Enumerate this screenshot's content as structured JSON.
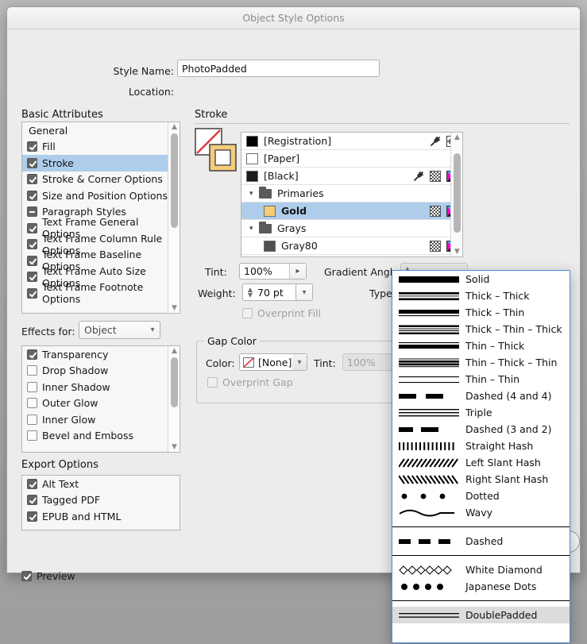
{
  "window": {
    "title": "Object Style Options"
  },
  "form": {
    "style_name_label": "Style Name:",
    "style_name_value": "PhotoPadded",
    "location_label": "Location:",
    "location_value": ""
  },
  "basic_attributes": {
    "title": "Basic Attributes",
    "items": [
      {
        "label": "General",
        "checkbox": "none",
        "selected": false
      },
      {
        "label": "Fill",
        "checkbox": "checked",
        "selected": false
      },
      {
        "label": "Stroke",
        "checkbox": "checked",
        "selected": true
      },
      {
        "label": "Stroke & Corner Options",
        "checkbox": "checked",
        "selected": false
      },
      {
        "label": "Size and Position Options",
        "checkbox": "checked",
        "selected": false
      },
      {
        "label": "Paragraph Styles",
        "checkbox": "dash",
        "selected": false
      },
      {
        "label": "Text Frame General Options",
        "checkbox": "checked",
        "selected": false
      },
      {
        "label": "Text Frame Column Rule Options",
        "checkbox": "checked",
        "selected": false
      },
      {
        "label": "Text Frame Baseline Options",
        "checkbox": "checked",
        "selected": false
      },
      {
        "label": "Text Frame Auto Size Options",
        "checkbox": "checked",
        "selected": false
      },
      {
        "label": "Text Frame Footnote Options",
        "checkbox": "checked",
        "selected": false
      }
    ]
  },
  "effects": {
    "label": "Effects for:",
    "selected": "Object",
    "items": [
      {
        "label": "Transparency",
        "checkbox": "checked"
      },
      {
        "label": "Drop Shadow",
        "checkbox": "unchecked"
      },
      {
        "label": "Inner Shadow",
        "checkbox": "unchecked"
      },
      {
        "label": "Outer Glow",
        "checkbox": "unchecked"
      },
      {
        "label": "Inner Glow",
        "checkbox": "unchecked"
      },
      {
        "label": "Bevel and Emboss",
        "checkbox": "unchecked"
      }
    ]
  },
  "export_options": {
    "title": "Export Options",
    "items": [
      {
        "label": "Alt Text",
        "checkbox": "checked"
      },
      {
        "label": "Tagged PDF",
        "checkbox": "checked"
      },
      {
        "label": "EPUB and HTML",
        "checkbox": "checked"
      }
    ]
  },
  "preview": {
    "label": "Preview",
    "checkbox": "checked"
  },
  "stroke": {
    "title": "Stroke",
    "swatches": [
      {
        "name": "[Registration]",
        "color": "#000000",
        "indent": 0,
        "type": "swatch",
        "selected": false,
        "icons": [
          "ink-icon",
          "registration-icon"
        ]
      },
      {
        "name": "[Paper]",
        "color": "#ffffff",
        "indent": 0,
        "type": "swatch",
        "selected": false,
        "icons": []
      },
      {
        "name": "[Black]",
        "color": "#1b1b1b",
        "indent": 0,
        "type": "swatch",
        "selected": false,
        "icons": [
          "ink-icon",
          "tint-icon",
          "cmyk-icon"
        ]
      },
      {
        "name": "Primaries",
        "color": "",
        "indent": 0,
        "type": "group",
        "selected": false,
        "icons": []
      },
      {
        "name": "Gold",
        "color": "#f5cc78",
        "indent": 1,
        "type": "swatch",
        "selected": true,
        "icons": [
          "tint-icon",
          "cmyk-icon"
        ]
      },
      {
        "name": "Grays",
        "color": "",
        "indent": 0,
        "type": "group",
        "selected": false,
        "icons": []
      },
      {
        "name": "Gray80",
        "color": "#4f4f4f",
        "indent": 1,
        "type": "swatch",
        "selected": false,
        "icons": [
          "tint-icon",
          "cmyk-icon"
        ]
      }
    ],
    "tint_label": "Tint:",
    "tint_value": "100%",
    "gradient_angle_label": "Gradient Angle:",
    "gradient_angle_value": "",
    "weight_label": "Weight:",
    "weight_value": "70 pt",
    "type_label": "Type:",
    "type_value": "triple-rule-preview",
    "overprint_fill_label": "Overprint Fill",
    "overprint_fill_checkbox": "unchecked"
  },
  "gap_color": {
    "legend": "Gap Color",
    "color_label": "Color:",
    "color_value": "[None]",
    "tint_label": "Tint:",
    "tint_value": "100%",
    "overprint_gap_label": "Overprint Gap",
    "overprint_gap_checkbox": "unchecked"
  },
  "stroke_type_menu": {
    "groups": [
      {
        "items": [
          {
            "label": "Solid",
            "preview": "solid",
            "highlighted": false
          },
          {
            "label": "Thick – Thick",
            "preview": "thick-thick",
            "highlighted": false
          },
          {
            "label": "Thick – Thin",
            "preview": "thick-thin",
            "highlighted": false
          },
          {
            "label": "Thick – Thin – Thick",
            "preview": "thick-thin-thick",
            "highlighted": false
          },
          {
            "label": "Thin – Thick",
            "preview": "thin-thick",
            "highlighted": false
          },
          {
            "label": "Thin – Thick – Thin",
            "preview": "thin-thick-thin",
            "highlighted": false
          },
          {
            "label": "Thin – Thin",
            "preview": "thin-thin",
            "highlighted": false
          },
          {
            "label": "Dashed (4 and 4)",
            "preview": "dashed-4-4",
            "highlighted": false
          },
          {
            "label": "Triple",
            "preview": "triple",
            "highlighted": false
          },
          {
            "label": "Dashed (3 and 2)",
            "preview": "dashed-3-2",
            "highlighted": false
          },
          {
            "label": "Straight Hash",
            "preview": "straight-hash",
            "highlighted": false
          },
          {
            "label": "Left Slant Hash",
            "preview": "left-slant-hash",
            "highlighted": false
          },
          {
            "label": "Right Slant Hash",
            "preview": "right-slant-hash",
            "highlighted": false
          },
          {
            "label": "Dotted",
            "preview": "dotted",
            "highlighted": false
          },
          {
            "label": "Wavy",
            "preview": "wavy",
            "highlighted": false
          }
        ]
      },
      {
        "items": [
          {
            "label": "Dashed",
            "preview": "dashed-custom",
            "highlighted": false
          }
        ]
      },
      {
        "items": [
          {
            "label": "White Diamond",
            "preview": "white-diamond",
            "highlighted": false
          },
          {
            "label": "Japanese Dots",
            "preview": "japanese-dots",
            "highlighted": false
          }
        ]
      },
      {
        "items": [
          {
            "label": "DoublePadded",
            "preview": "double-rule",
            "highlighted": true
          }
        ]
      }
    ]
  },
  "colors": {
    "selection_blue": "#aecdeb",
    "menu_border_blue": "#4a90d9",
    "highlight_gray": "#dcdcdc",
    "gold_swatch": "#f5cc78",
    "window_bg": "#ececec"
  }
}
